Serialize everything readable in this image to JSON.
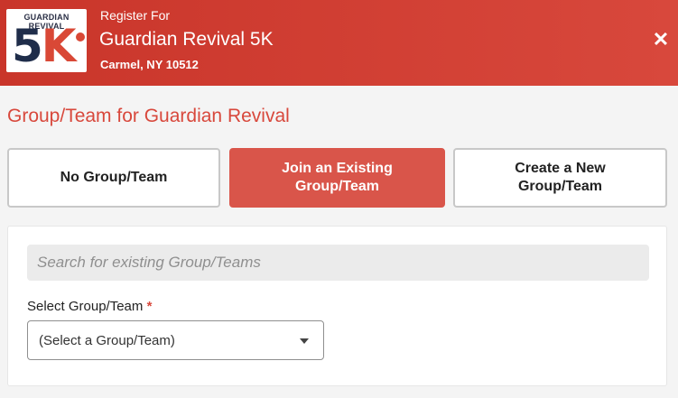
{
  "header": {
    "pre_title": "Register For",
    "title": "Guardian Revival 5K",
    "location": "Carmel, NY 10512",
    "close_glyph": "✕",
    "logo": {
      "top_text": "GUARDIAN REVIVAL",
      "big_text_5": "5",
      "big_text_k": "K"
    }
  },
  "section": {
    "title": "Group/Team for Guardian Revival"
  },
  "options": [
    {
      "label": "No Group/Team",
      "state": "default"
    },
    {
      "label": "Join an Existing Group/Team",
      "state": "selected"
    },
    {
      "label": "Create a New Group/Team",
      "state": "default"
    }
  ],
  "panel": {
    "search_placeholder": "Search for existing Group/Teams",
    "select_label": "Select Group/Team",
    "required_marker": "*",
    "select_value": "(Select a Group/Team)"
  },
  "colors": {
    "accent": "#d8483c",
    "header": "#c9352a",
    "selected": "#d9554a"
  }
}
